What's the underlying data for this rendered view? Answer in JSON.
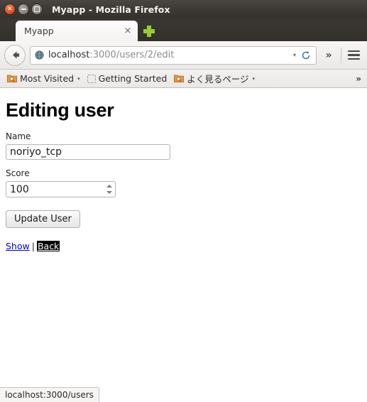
{
  "window": {
    "title": "Myapp - Mozilla Firefox",
    "controls": {
      "close": "close-button",
      "minimize": "minimize-button",
      "maximize": "maximize-button"
    }
  },
  "tabs": {
    "items": [
      {
        "label": "Myapp",
        "close_label": "×"
      }
    ],
    "new_tab_label": "+"
  },
  "toolbar": {
    "back_label": "←",
    "url": {
      "host": "localhost",
      "path": ":3000/users/2/edit",
      "full": "localhost:3000/users/2/edit",
      "dropdown_label": "▾",
      "reload_label": "↻"
    },
    "overflow_label": "»",
    "menu_label": "≡"
  },
  "bookmarks": {
    "items": [
      {
        "label": "Most Visited",
        "icon": "folder-search-icon",
        "has_arrow": true,
        "arrow": "▾"
      },
      {
        "label": "Getting Started",
        "icon": "dashed-placeholder-icon",
        "has_arrow": false,
        "arrow": ""
      },
      {
        "label": "よく見るページ",
        "icon": "folder-search-icon",
        "has_arrow": true,
        "arrow": "▾"
      }
    ],
    "overflow_label": "»"
  },
  "page": {
    "heading": "Editing user",
    "fields": {
      "name": {
        "label": "Name",
        "value": "noriyo_tcp",
        "placeholder": ""
      },
      "score": {
        "label": "Score",
        "value": "100",
        "placeholder": ""
      }
    },
    "submit_label": "Update User",
    "links": {
      "show_label": "Show",
      "separator": "|",
      "back_label": "Back"
    }
  },
  "status": {
    "text": "localhost:3000/users"
  },
  "colors": {
    "titlebar_dark": "#3d3935",
    "close_orange": "#df4f22",
    "newtab_green": "#99cc33",
    "bookmark_orange": "#e07b28",
    "link_blue": "#0000ee",
    "focus_black": "#000000"
  }
}
